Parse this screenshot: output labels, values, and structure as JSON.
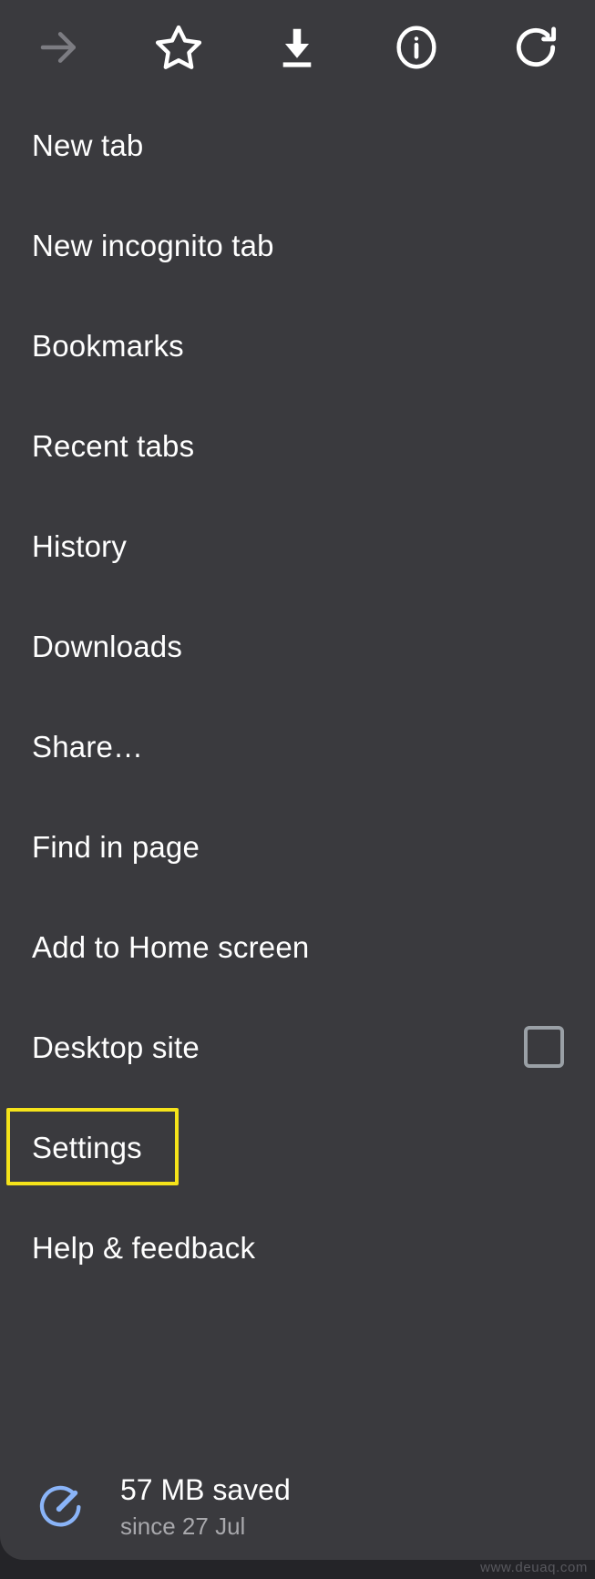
{
  "window": {
    "background_color": "#3a3a3e",
    "outer_background_color": "#242428",
    "text_color": "#ffffff",
    "secondary_text_color": "#a8a8ac",
    "highlight_color": "#f5e31a",
    "accent_color": "#8ab4f8"
  },
  "toolbar": {
    "buttons": [
      {
        "name": "forward-arrow-icon",
        "label": "Forward",
        "state": "disabled",
        "color": "#7c7c82"
      },
      {
        "name": "star-icon",
        "label": "Bookmark",
        "state": "enabled",
        "color": "#ffffff"
      },
      {
        "name": "download-icon",
        "label": "Download page",
        "state": "enabled",
        "color": "#ffffff"
      },
      {
        "name": "info-circle-icon",
        "label": "Page info",
        "state": "enabled",
        "color": "#ffffff"
      },
      {
        "name": "reload-icon",
        "label": "Reload",
        "state": "enabled",
        "color": "#ffffff"
      }
    ]
  },
  "menu": {
    "items": [
      {
        "id": "new-tab",
        "label": "New tab",
        "control": "none"
      },
      {
        "id": "new-incognito-tab",
        "label": "New incognito tab",
        "control": "none"
      },
      {
        "id": "bookmarks",
        "label": "Bookmarks",
        "control": "none"
      },
      {
        "id": "recent-tabs",
        "label": "Recent tabs",
        "control": "none"
      },
      {
        "id": "history",
        "label": "History",
        "control": "none"
      },
      {
        "id": "downloads",
        "label": "Downloads",
        "control": "none"
      },
      {
        "id": "share",
        "label": "Share…",
        "control": "none"
      },
      {
        "id": "find-in-page",
        "label": "Find in page",
        "control": "none"
      },
      {
        "id": "add-to-home-screen",
        "label": "Add to Home screen",
        "control": "none"
      },
      {
        "id": "desktop-site",
        "label": "Desktop site",
        "control": "checkbox",
        "checked": false
      },
      {
        "id": "settings",
        "label": "Settings",
        "control": "none",
        "highlighted": true
      },
      {
        "id": "help-and-feedback",
        "label": "Help & feedback",
        "control": "none"
      }
    ]
  },
  "data_saver": {
    "icon": "speedometer-icon",
    "primary": "57 MB saved",
    "secondary": "since 27 Jul"
  },
  "watermark": {
    "text": "www.deuaq.com"
  }
}
